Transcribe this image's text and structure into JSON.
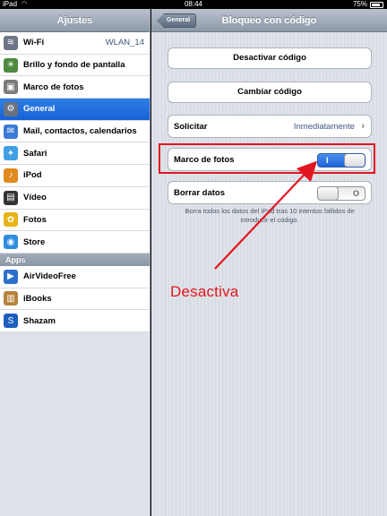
{
  "status_bar": {
    "carrier": "iPad",
    "time": "08:44",
    "battery": "75%",
    "battery_level": 0.75
  },
  "sidebar": {
    "title": "Ajustes",
    "items": [
      {
        "label": "Wi-Fi",
        "value": "WLAN_14",
        "icon": "wifi-icon",
        "color": "#6d7687"
      },
      {
        "label": "Brillo y fondo de pantalla",
        "icon": "brightness-icon",
        "color": "#4d8a3f"
      },
      {
        "label": "Marco de fotos",
        "icon": "picture-frame-icon",
        "color": "#7b7b7b"
      },
      {
        "label": "General",
        "icon": "gear-icon",
        "color": "#6a7280",
        "selected": true
      },
      {
        "label": "Mail, contactos, calendarios",
        "icon": "mail-icon",
        "color": "#3c7bd6"
      },
      {
        "label": "Safari",
        "icon": "safari-compass-icon",
        "color": "#3fa0e6"
      },
      {
        "label": "iPod",
        "icon": "music-note-icon",
        "color": "#e08a1f"
      },
      {
        "label": "Vídeo",
        "icon": "film-icon",
        "color": "#333333"
      },
      {
        "label": "Fotos",
        "icon": "sunflower-icon",
        "color": "#e8b317"
      },
      {
        "label": "Store",
        "icon": "app-store-icon",
        "color": "#2f8de0"
      }
    ],
    "apps_header": "Apps",
    "apps": [
      {
        "label": "AirVideoFree",
        "icon": "airvideo-icon",
        "color": "#2d6fcb"
      },
      {
        "label": "iBooks",
        "icon": "book-icon",
        "color": "#b5823a"
      },
      {
        "label": "Shazam",
        "icon": "shazam-icon",
        "color": "#1e5fbf"
      }
    ]
  },
  "detail": {
    "title": "Bloqueo con código",
    "back_label": "General",
    "deactivate_label": "Desactivar código",
    "change_label": "Cambiar código",
    "require_label": "Solicitar",
    "require_value": "Inmediatamente",
    "photo_frame_label": "Marco de fotos",
    "photo_frame_toggle": "on",
    "photo_frame_on_glyph": "I",
    "erase_label": "Borrar datos",
    "erase_toggle": "off",
    "erase_off_glyph": "O",
    "erase_note": "Borra todos los datos del iPad tras 10 intentos fallidos de introducir el código."
  },
  "annotation": {
    "text": "Desactiva",
    "color": "#e3161f"
  }
}
